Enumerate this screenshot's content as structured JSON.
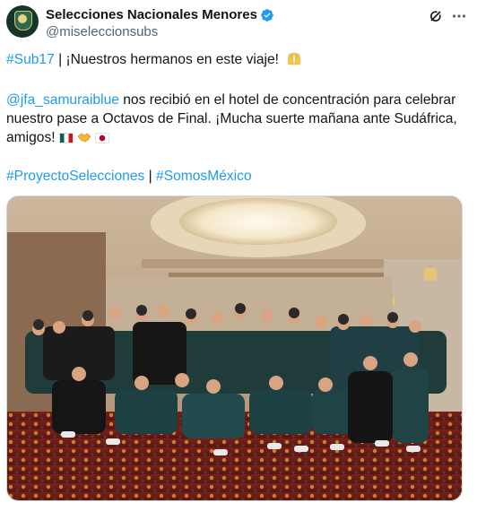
{
  "author": {
    "display_name": "Selecciones Nacionales Menores",
    "handle": "@miseleccionsubs"
  },
  "icons": {
    "avatar": "seleccion-mexicana-crest",
    "verified": "verified-badge-icon",
    "grok": "grok-icon",
    "more": "more-icon"
  },
  "post": {
    "line1_hashtag": "#Sub17",
    "line1_text": " | ¡Nuestros hermanos en este viaje! ",
    "line2_mention": "@jfa_samuraiblue",
    "line2_text": " nos recibió en el hotel de concentración para celebrar nuestro pase a Octavos de Final. ¡Mucha suerte mañana ante Sudáfrica, amigos! ",
    "hashtag_1": "#ProyectoSelecciones",
    "separator": " | ",
    "hashtag_2": "#SomosMéxico"
  },
  "colors": {
    "link": "#1d9bf0",
    "text": "#0f1419",
    "secondary": "#536471",
    "verified": "#1d9bf0"
  }
}
